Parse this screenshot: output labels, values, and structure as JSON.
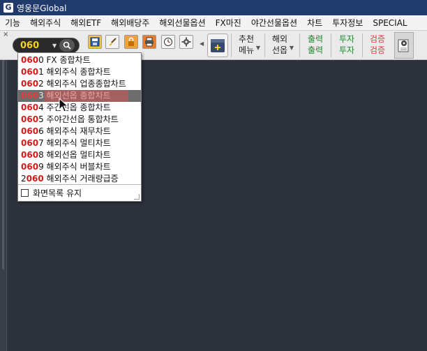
{
  "window": {
    "title": "영웅문Global",
    "logo": "G"
  },
  "menu": {
    "items": [
      "기능",
      "해외주식",
      "해외ETF",
      "해외배당주",
      "해외선물옵션",
      "FX마진",
      "야간선물옵션",
      "차트",
      "투자정보",
      "SPECIAL"
    ]
  },
  "toolbar": {
    "close": "×",
    "search": {
      "value": "060"
    },
    "recommend_menu": {
      "line1": "추천",
      "line2": "메뉴"
    },
    "overseas_options": {
      "line1": "해외",
      "line2": "선옵"
    },
    "output": {
      "line1": "출력",
      "line2": "출력"
    },
    "invest": {
      "line1": "투자",
      "line2": "투자"
    },
    "verify": {
      "line1": "검증",
      "line2": "검증"
    }
  },
  "dropdown": {
    "items": [
      {
        "code_hi": "060",
        "code_rest": "0",
        "label": "FX 종합차트"
      },
      {
        "code_hi": "060",
        "code_rest": "1",
        "label": "해외주식 종합차트"
      },
      {
        "code_hi": "060",
        "code_rest": "2",
        "label": "해외주식 업종종합차트"
      },
      {
        "code_hi": "060",
        "code_rest": "3",
        "label": "해외선옵 종합차트"
      },
      {
        "code_hi": "060",
        "code_rest": "4",
        "label": "주간선옵 종합차트"
      },
      {
        "code_hi": "060",
        "code_rest": "5",
        "label": "주야간선옵 통합차트"
      },
      {
        "code_hi": "060",
        "code_rest": "6",
        "label": "해외주식 재무차트"
      },
      {
        "code_hi": "060",
        "code_rest": "7",
        "label": "해외주식 멀티차트"
      },
      {
        "code_hi": "060",
        "code_rest": "8",
        "label": "해외선옵 멀티차트"
      },
      {
        "code_hi": "060",
        "code_rest": "9",
        "label": "해외주식 버블차트"
      },
      {
        "code_pre": "2",
        "code_hi": "060",
        "label": "해외주식 거래량급증"
      }
    ],
    "selected_index": 3,
    "keep_list_label": "화면목록 유지"
  },
  "colors": {
    "titlebar": "#1f3a6b",
    "workspace": "#2e323c",
    "code_highlight": "#d11a1a",
    "search_text": "#f5d21c"
  }
}
